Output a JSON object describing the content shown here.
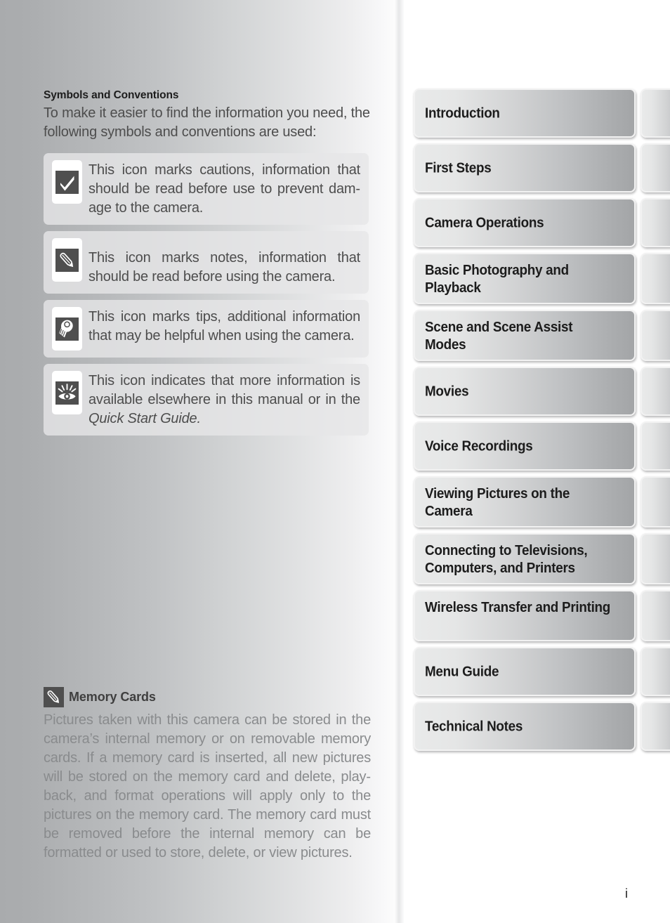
{
  "page": {
    "number": "i"
  },
  "left": {
    "heading": "Symbols and Conventions",
    "intro": "To make it easier to find the information you need, the following symbols and conventions are used:",
    "symbols": [
      {
        "icon": "checkmark-icon",
        "text": "This icon marks cautions, information that should be read before use to prevent dam­age to the camera."
      },
      {
        "icon": "pencil-icon",
        "text": "This icon marks notes, information that should be read before using the camera."
      },
      {
        "icon": "lightbulb-icon",
        "text": "This icon marks tips, additional information that may be helpful when using the cam­era."
      },
      {
        "icon": "eye-icon",
        "text_before": "This icon indicates that more information is available elsewhere in this manual or in the ",
        "text_italic": "Quick Start Guide.",
        "text_after": ""
      }
    ]
  },
  "note": {
    "icon": "pencil-icon",
    "title": "Memory Cards",
    "body": "Pictures taken with this camera can be stored in the camera’s internal memory or on removable memory cards.  If a memory card is inserted, all new pictures will be stored on the memory card and delete, play­back, and format operations will apply only to the pictures on the memory card.  The memory card must be removed before the internal memory can be formatted or used to store, delete, or view pic­tures."
  },
  "tabs": [
    {
      "label": "Introduction",
      "lines": 1
    },
    {
      "label": "First Steps",
      "lines": 1
    },
    {
      "label": "Camera Operations",
      "lines": 1
    },
    {
      "label": "Basic Photography and Playback",
      "lines": 2
    },
    {
      "label": "Scene and Scene Assist Modes",
      "lines": 2
    },
    {
      "label": "Movies",
      "lines": 1
    },
    {
      "label": "Voice Recordings",
      "lines": 1
    },
    {
      "label": "Viewing Pictures on the Camera",
      "lines": 2
    },
    {
      "label": "Connecting to Televisions, Computers, and Printers",
      "lines": 2
    },
    {
      "label": "Wireless Transfer and Printing",
      "lines": 2
    },
    {
      "label": "Menu Guide",
      "lines": 1
    },
    {
      "label": "Technical Notes",
      "lines": 1
    }
  ],
  "colors": {
    "icon_glyph_bg": "#4f4f4f",
    "symbol_box_bg": "#e6e6e7",
    "tab_text": "#1c1c1c",
    "note_body_text": "#898b8d",
    "body_text": "#4d4d4d"
  }
}
